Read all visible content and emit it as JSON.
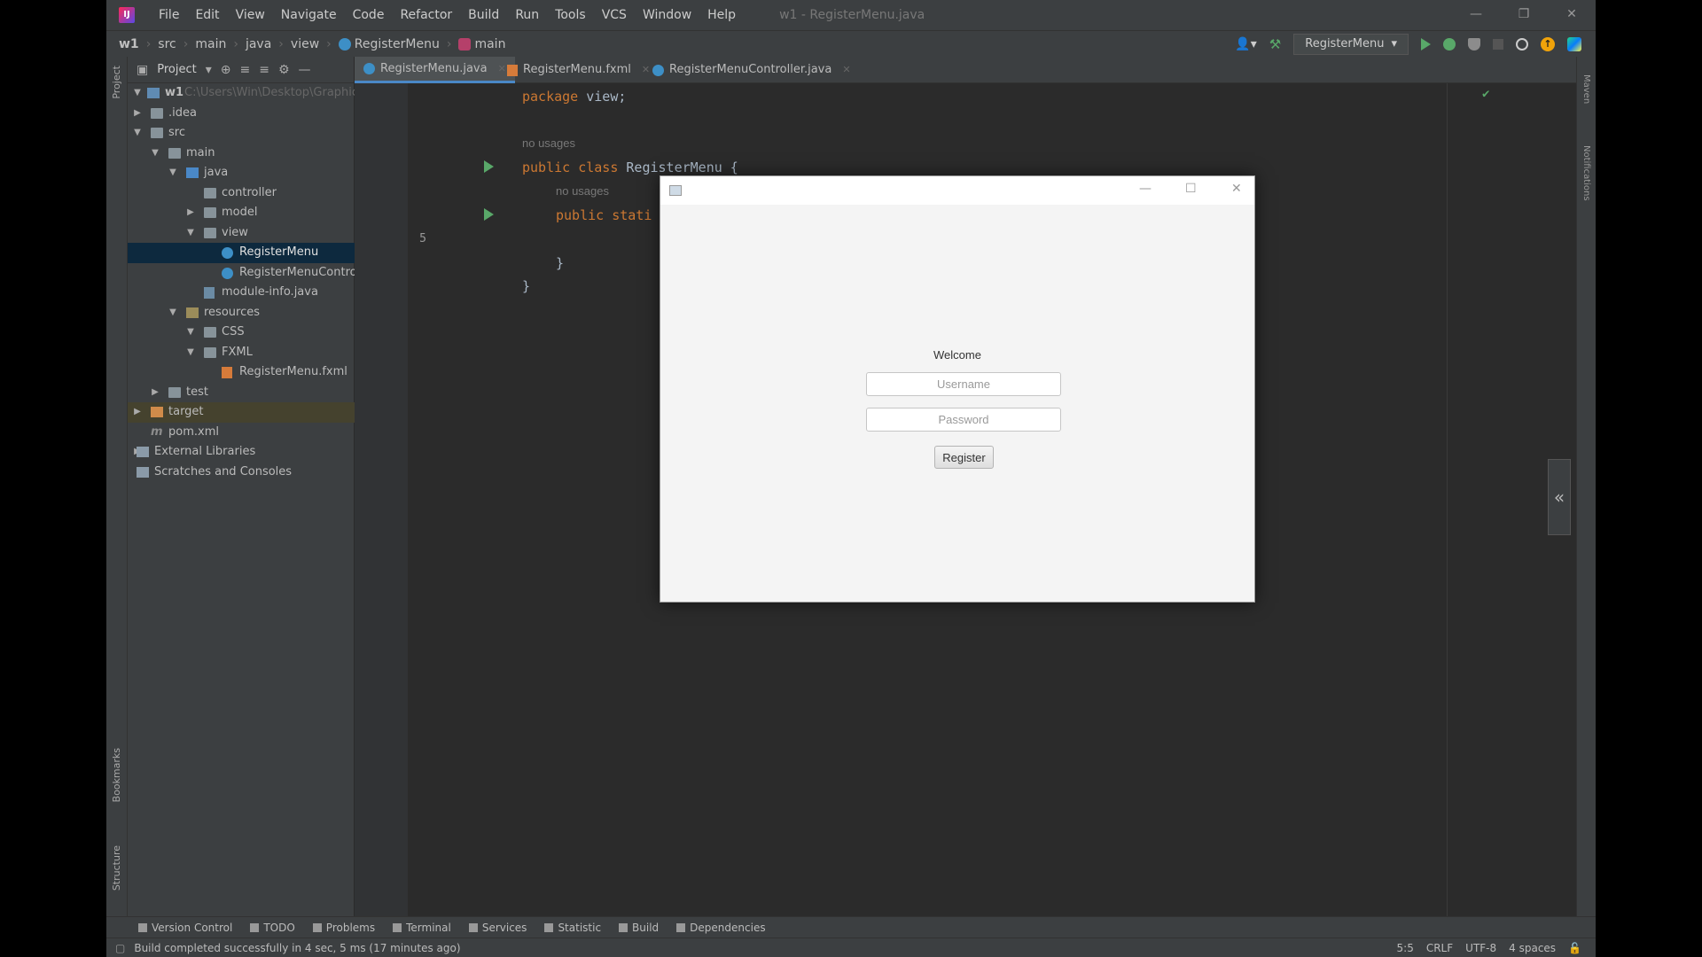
{
  "app": {
    "logo_text": "IJ",
    "window_title": "w1 - RegisterMenu.java",
    "menu": [
      "File",
      "Edit",
      "View",
      "Navigate",
      "Code",
      "Refactor",
      "Build",
      "Run",
      "Tools",
      "VCS",
      "Window",
      "Help"
    ],
    "window_controls": {
      "minimize": "—",
      "restore": "❐",
      "close": "✕"
    }
  },
  "breadcrumb": {
    "items": [
      "w1",
      "src",
      "main",
      "java",
      "view",
      "RegisterMenu",
      "main"
    ]
  },
  "toolbar": {
    "run_config": "RegisterMenu",
    "update_badge": "↑"
  },
  "project_panel": {
    "title": "Project",
    "root_name": "w1",
    "root_path": "C:\\Users\\Win\\Desktop\\Graphic",
    "tree": {
      "idea": ".idea",
      "src": "src",
      "main": "main",
      "java": "java",
      "controller": "controller",
      "model": "model",
      "view": "view",
      "register_menu": "RegisterMenu",
      "register_menu_controller": "RegisterMenuContro",
      "module_info": "module-info.java",
      "resources": "resources",
      "css": "CSS",
      "fxml": "FXML",
      "register_menu_fxml": "RegisterMenu.fxml",
      "test": "test",
      "target": "target",
      "pom": "pom.xml",
      "external_libraries": "External Libraries",
      "scratches": "Scratches and Consoles"
    }
  },
  "side_stripes": {
    "left_top": "Project",
    "left_bookmarks": "Bookmarks",
    "left_structure": "Structure",
    "right_maven": "Maven",
    "right_notifications": "Notifications"
  },
  "tabs": [
    {
      "label": "RegisterMenu.java"
    },
    {
      "label": "RegisterMenu.fxml"
    },
    {
      "label": "RegisterMenuController.java"
    }
  ],
  "editor": {
    "line1_kw": "package",
    "line1_rest": " view;",
    "hint1": "no usages",
    "line3_kw": "public class",
    "line3_rest": " RegisterMenu {",
    "hint2": "no usages",
    "line5_kw": "public stati",
    "line_number": "5",
    "close_inner": "}",
    "close_outer": "}"
  },
  "dialog": {
    "welcome": "Welcome",
    "username_placeholder": "Username",
    "password_placeholder": "Password",
    "register_button": "Register"
  },
  "tool_windows": [
    "Version Control",
    "TODO",
    "Problems",
    "Terminal",
    "Services",
    "Statistic",
    "Build",
    "Dependencies"
  ],
  "status": {
    "message": "Build completed successfully in 4 sec, 5 ms (17 minutes ago)",
    "position": "5:5",
    "line_sep": "CRLF",
    "encoding": "UTF-8",
    "indent": "4 spaces"
  },
  "colors": {
    "ide_bg": "#2b2b2b",
    "panel_bg": "#3c3f41",
    "keyword": "#cc7832",
    "run_green": "#59a869",
    "selection": "#0d293e"
  }
}
